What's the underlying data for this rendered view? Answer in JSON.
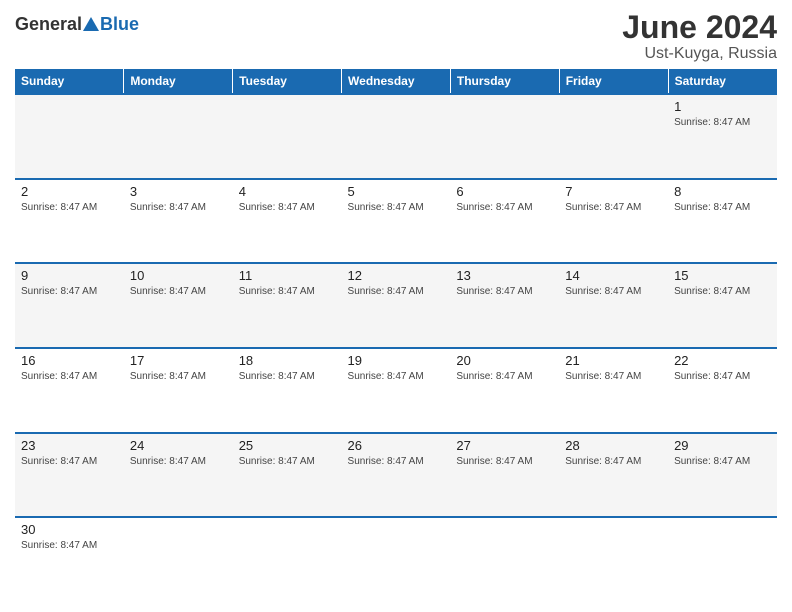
{
  "header": {
    "logo_general": "General",
    "logo_blue": "Blue",
    "title": "June 2024",
    "subtitle": "Ust-Kuyga, Russia"
  },
  "days_of_week": [
    "Sunday",
    "Monday",
    "Tuesday",
    "Wednesday",
    "Thursday",
    "Friday",
    "Saturday"
  ],
  "accent_color": "#1a6ab1",
  "sunrise_text": "Sunrise: 8:47 AM",
  "weeks": [
    {
      "days": [
        {
          "number": "",
          "info": "",
          "empty": true
        },
        {
          "number": "",
          "info": "",
          "empty": true
        },
        {
          "number": "",
          "info": "",
          "empty": true
        },
        {
          "number": "",
          "info": "",
          "empty": true
        },
        {
          "number": "",
          "info": "",
          "empty": true
        },
        {
          "number": "",
          "info": "",
          "empty": true
        },
        {
          "number": "1",
          "info": "Sunrise: 8:47 AM",
          "empty": false
        }
      ]
    },
    {
      "days": [
        {
          "number": "2",
          "info": "Sunrise: 8:47 AM",
          "empty": false
        },
        {
          "number": "3",
          "info": "Sunrise: 8:47 AM",
          "empty": false
        },
        {
          "number": "4",
          "info": "Sunrise: 8:47 AM",
          "empty": false
        },
        {
          "number": "5",
          "info": "Sunrise: 8:47 AM",
          "empty": false
        },
        {
          "number": "6",
          "info": "Sunrise: 8:47 AM",
          "empty": false
        },
        {
          "number": "7",
          "info": "Sunrise: 8:47 AM",
          "empty": false
        },
        {
          "number": "8",
          "info": "Sunrise: 8:47 AM",
          "empty": false
        }
      ]
    },
    {
      "days": [
        {
          "number": "9",
          "info": "Sunrise: 8:47 AM",
          "empty": false
        },
        {
          "number": "10",
          "info": "Sunrise: 8:47 AM",
          "empty": false
        },
        {
          "number": "11",
          "info": "Sunrise: 8:47 AM",
          "empty": false
        },
        {
          "number": "12",
          "info": "Sunrise: 8:47 AM",
          "empty": false
        },
        {
          "number": "13",
          "info": "Sunrise: 8:47 AM",
          "empty": false
        },
        {
          "number": "14",
          "info": "Sunrise: 8:47 AM",
          "empty": false
        },
        {
          "number": "15",
          "info": "Sunrise: 8:47 AM",
          "empty": false
        }
      ]
    },
    {
      "days": [
        {
          "number": "16",
          "info": "Sunrise: 8:47 AM",
          "empty": false
        },
        {
          "number": "17",
          "info": "Sunrise: 8:47 AM",
          "empty": false
        },
        {
          "number": "18",
          "info": "Sunrise: 8:47 AM",
          "empty": false
        },
        {
          "number": "19",
          "info": "Sunrise: 8:47 AM",
          "empty": false
        },
        {
          "number": "20",
          "info": "Sunrise: 8:47 AM",
          "empty": false
        },
        {
          "number": "21",
          "info": "Sunrise: 8:47 AM",
          "empty": false
        },
        {
          "number": "22",
          "info": "Sunrise: 8:47 AM",
          "empty": false
        }
      ]
    },
    {
      "days": [
        {
          "number": "23",
          "info": "Sunrise: 8:47 AM",
          "empty": false
        },
        {
          "number": "24",
          "info": "Sunrise: 8:47 AM",
          "empty": false
        },
        {
          "number": "25",
          "info": "Sunrise: 8:47 AM",
          "empty": false
        },
        {
          "number": "26",
          "info": "Sunrise: 8:47 AM",
          "empty": false
        },
        {
          "number": "27",
          "info": "Sunrise: 8:47 AM",
          "empty": false
        },
        {
          "number": "28",
          "info": "Sunrise: 8:47 AM",
          "empty": false
        },
        {
          "number": "29",
          "info": "Sunrise: 8:47 AM",
          "empty": false
        }
      ]
    },
    {
      "days": [
        {
          "number": "30",
          "info": "Sunrise: 8:47 AM",
          "empty": false
        },
        {
          "number": "",
          "info": "",
          "empty": true
        },
        {
          "number": "",
          "info": "",
          "empty": true
        },
        {
          "number": "",
          "info": "",
          "empty": true
        },
        {
          "number": "",
          "info": "",
          "empty": true
        },
        {
          "number": "",
          "info": "",
          "empty": true
        },
        {
          "number": "",
          "info": "",
          "empty": true
        }
      ]
    }
  ]
}
